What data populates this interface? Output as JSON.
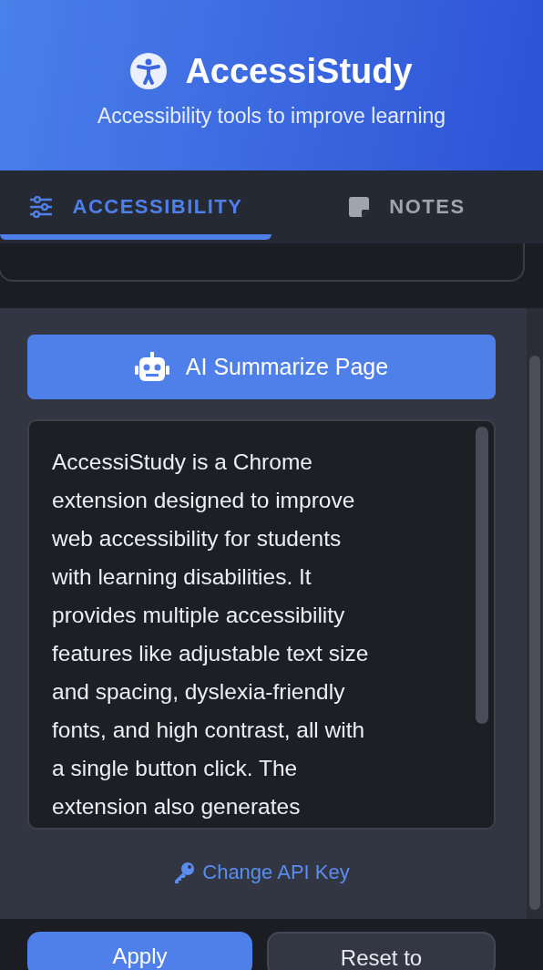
{
  "header": {
    "title": "AccessiStudy",
    "subtitle": "Accessibility tools to improve learning"
  },
  "tabs": [
    {
      "label": "ACCESSIBILITY",
      "kind": "sliders",
      "selected": true
    },
    {
      "label": "NOTES",
      "kind": "note",
      "selected": false
    }
  ],
  "summary": {
    "button": "AI Summarize Page",
    "text": "AccessiStudy is a Chrome\nextension designed to improve\nweb accessibility for students\nwith learning disabilities. It\nprovides multiple accessibility\nfeatures like adjustable text size\nand spacing, dyslexia-friendly\nfonts, and high contrast, all with\na single button click. The\nextension also generates",
    "link": "Change API Key"
  },
  "footer": {
    "buttons": [
      {
        "label": "Apply",
        "kind": "primary"
      },
      {
        "label": "Reset to",
        "kind": "secondary"
      }
    ]
  }
}
